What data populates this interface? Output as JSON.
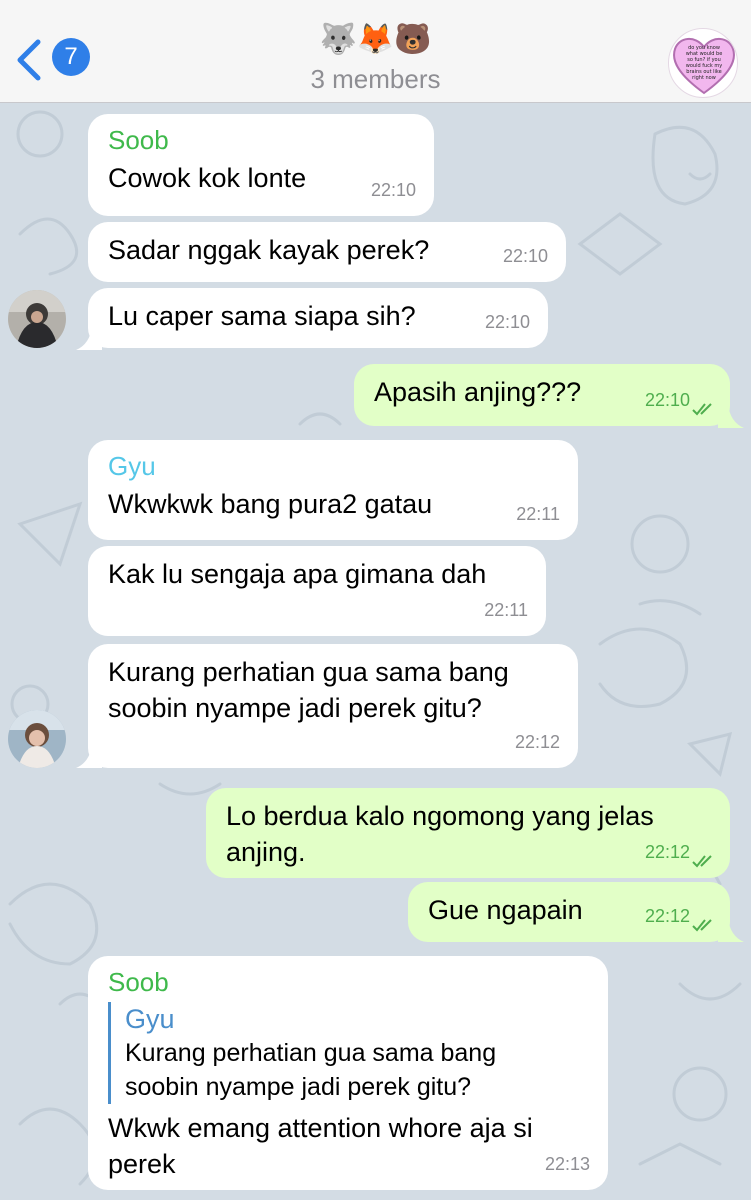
{
  "header": {
    "back_count": "7",
    "title_emojis": "🐺🦊🐻",
    "subtitle": "3 members",
    "avatar_text": "do you know what would be so fun? if you would fuck my brains out like right now"
  },
  "messages": [
    {
      "id": "m1",
      "sender": "Soob",
      "text": "Cowok kok lonte",
      "time": "22:10"
    },
    {
      "id": "m2",
      "text": "Sadar nggak kayak perek?",
      "time": "22:10"
    },
    {
      "id": "m3",
      "text": "Lu caper sama siapa sih?",
      "time": "22:10"
    },
    {
      "id": "m4",
      "text": "Apasih anjing???",
      "time": "22:10"
    },
    {
      "id": "m5",
      "sender": "Gyu",
      "text": "Wkwkwk bang pura2 gatau",
      "time": "22:11"
    },
    {
      "id": "m6",
      "text": "Kak lu sengaja apa gimana dah",
      "time": "22:11"
    },
    {
      "id": "m7",
      "text": "Kurang perhatian gua sama bang\nsoobin nyampe jadi perek gitu?",
      "time": "22:12"
    },
    {
      "id": "m8",
      "text": "Lo berdua kalo ngomong yang jelas\nanjing.",
      "time": "22:12"
    },
    {
      "id": "m9",
      "text": "Gue ngapain",
      "time": "22:12"
    },
    {
      "id": "m10",
      "sender": "Soob",
      "reply_to": {
        "name": "Gyu",
        "text": "Kurang perhatian gua sama bang\nsoobin nyampe jadi perek gitu?"
      },
      "text": "Wkwk emang attention whore aja si\nperek",
      "time": "22:13"
    }
  ],
  "colors": {
    "incoming_bubble": "#ffffff",
    "outgoing_bubble": "#e2ffc7",
    "sender_soob": "#3fb94b",
    "sender_gyu": "#55c7e8",
    "accent": "#2f7fe8",
    "read_ticks": "#4fae4e"
  },
  "icons": [
    "chevron-left-icon",
    "double-check-icon",
    "group-avatar-heart"
  ]
}
